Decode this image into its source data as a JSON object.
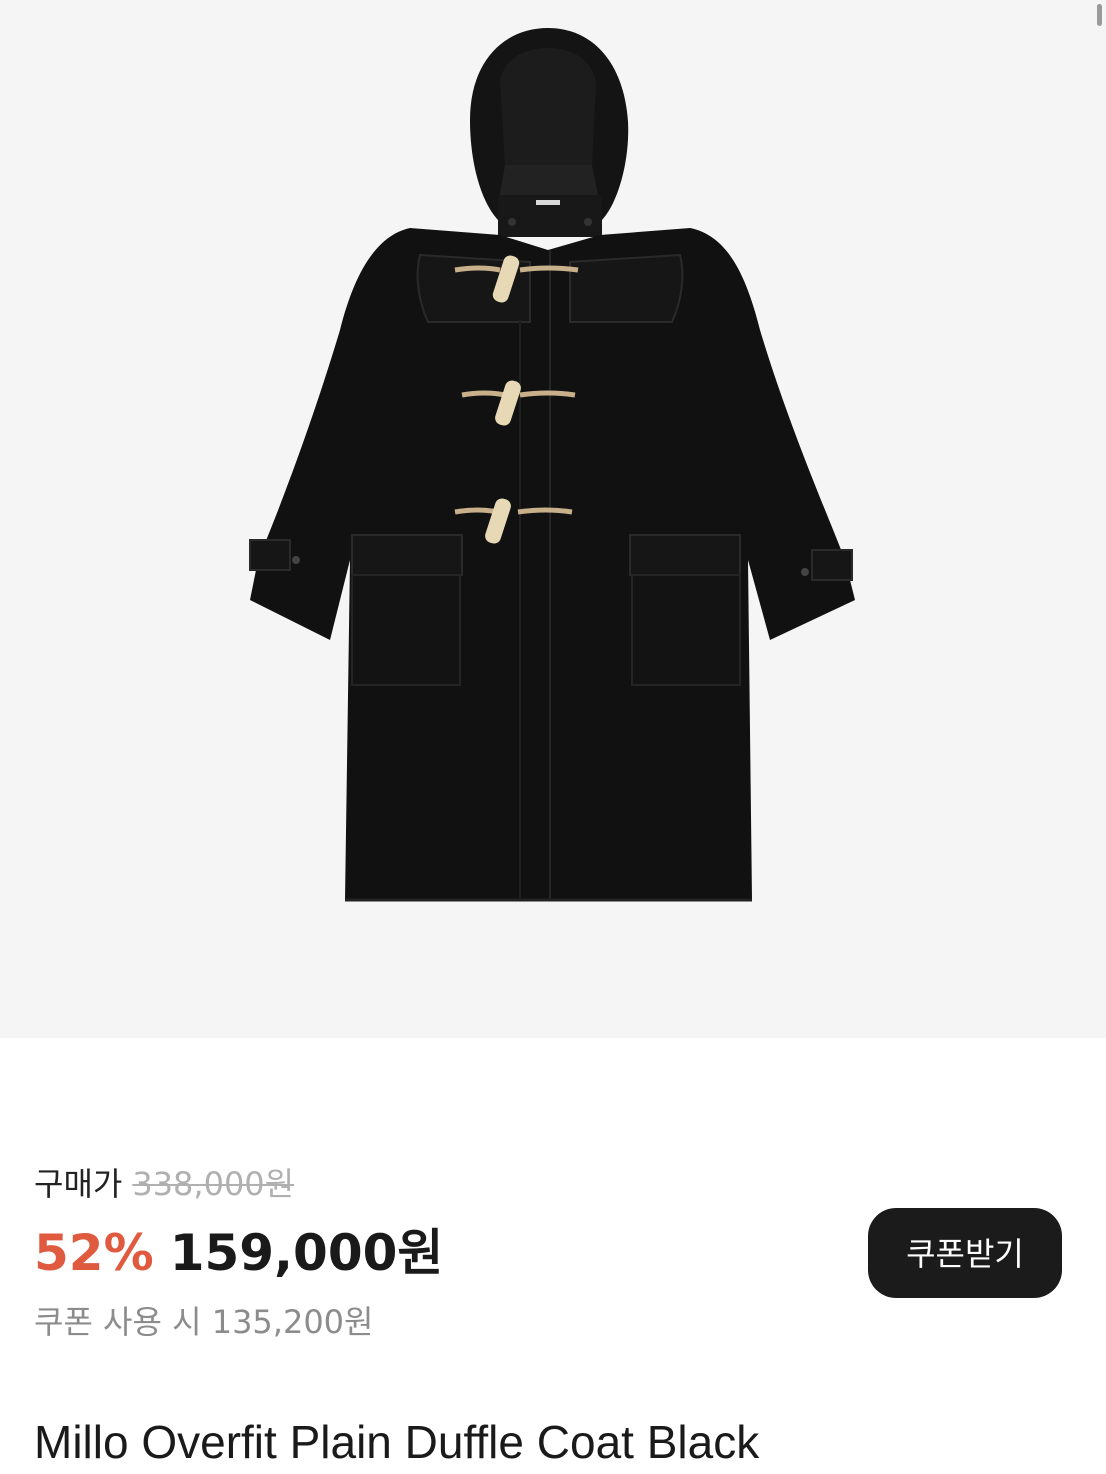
{
  "product": {
    "image_alt": "duffle-coat-photo",
    "name": "Millo Overfit Plain Duffle Coat Black"
  },
  "pricing": {
    "label": "구매가",
    "original_price": "338,000원",
    "discount_rate": "52%",
    "sale_price": "159,000원",
    "coupon_price_text": "쿠폰 사용 시 135,200원"
  },
  "coupon_button": {
    "label": "쿠폰받기"
  },
  "colors": {
    "accent_discount": "#e05a3f",
    "button_bg": "#1b1b1b",
    "hero_bg": "#f5f5f5"
  }
}
